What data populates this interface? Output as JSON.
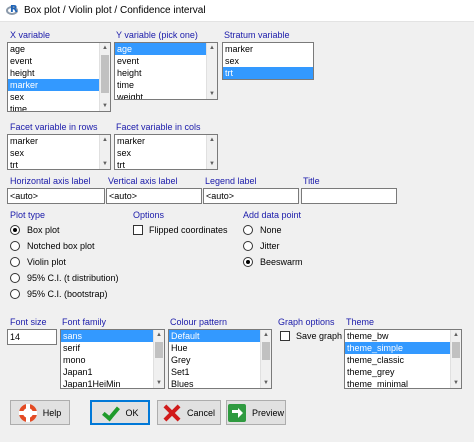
{
  "window": {
    "title": "Box plot / Violin plot / Confidence interval"
  },
  "x_variable": {
    "label": "X variable",
    "items": [
      "age",
      "event",
      "height",
      "marker",
      "sex",
      "time"
    ],
    "selected": 3
  },
  "y_variable": {
    "label": "Y variable (pick one)",
    "items": [
      "age",
      "event",
      "height",
      "time",
      "weight"
    ],
    "selected": 0
  },
  "stratum_variable": {
    "label": "Stratum variable",
    "items": [
      "marker",
      "sex",
      "trt"
    ],
    "selected": 2
  },
  "facet_rows": {
    "label": "Facet variable in rows",
    "items": [
      "marker",
      "sex",
      "trt"
    ]
  },
  "facet_cols": {
    "label": "Facet variable in cols",
    "items": [
      "marker",
      "sex",
      "trt"
    ]
  },
  "axis_labels": {
    "horizontal_label": "Horizontal axis label",
    "horizontal_value": "<auto>",
    "vertical_label": "Vertical axis label",
    "vertical_value": "<auto>",
    "legend_label": "Legend label",
    "legend_value": "<auto>",
    "title_label": "Title",
    "title_value": ""
  },
  "plot_type": {
    "label": "Plot type",
    "options": [
      "Box plot",
      "Notched box plot",
      "Violin plot",
      "95% C.I. (t distribution)",
      "95% C.I. (bootstrap)"
    ],
    "selected": 0
  },
  "options": {
    "label": "Options",
    "flipped_label": "Flipped coordinates",
    "flipped_checked": false
  },
  "add_data_point": {
    "label": "Add data point",
    "options": [
      "None",
      "Jitter",
      "Beeswarm"
    ],
    "selected": 2
  },
  "font_size": {
    "label": "Font size",
    "value": "14"
  },
  "font_family": {
    "label": "Font family",
    "items": [
      "sans",
      "serif",
      "mono",
      "Japan1",
      "Japan1HeiMin"
    ],
    "selected": 0
  },
  "colour_pattern": {
    "label": "Colour pattern",
    "items": [
      "Default",
      "Hue",
      "Grey",
      "Set1",
      "Blues"
    ],
    "selected": 0
  },
  "graph_options": {
    "label": "Graph options",
    "save_graph_label": "Save graph",
    "save_graph_checked": false
  },
  "theme": {
    "label": "Theme",
    "items": [
      "theme_bw",
      "theme_simple",
      "theme_classic",
      "theme_grey",
      "theme_minimal"
    ],
    "selected": 1
  },
  "buttons": {
    "help": "Help",
    "ok": "OK",
    "cancel": "Cancel",
    "preview": "Preview"
  },
  "colors": {
    "label_blue": "#1a1aaa",
    "selection": "#3399ff",
    "check_green": "#1f9a2b",
    "cancel_red": "#d11b1b"
  },
  "icons": {
    "help": "lifebuoy-icon",
    "ok": "check-icon",
    "cancel": "x-icon",
    "preview": "arrow-icon"
  }
}
